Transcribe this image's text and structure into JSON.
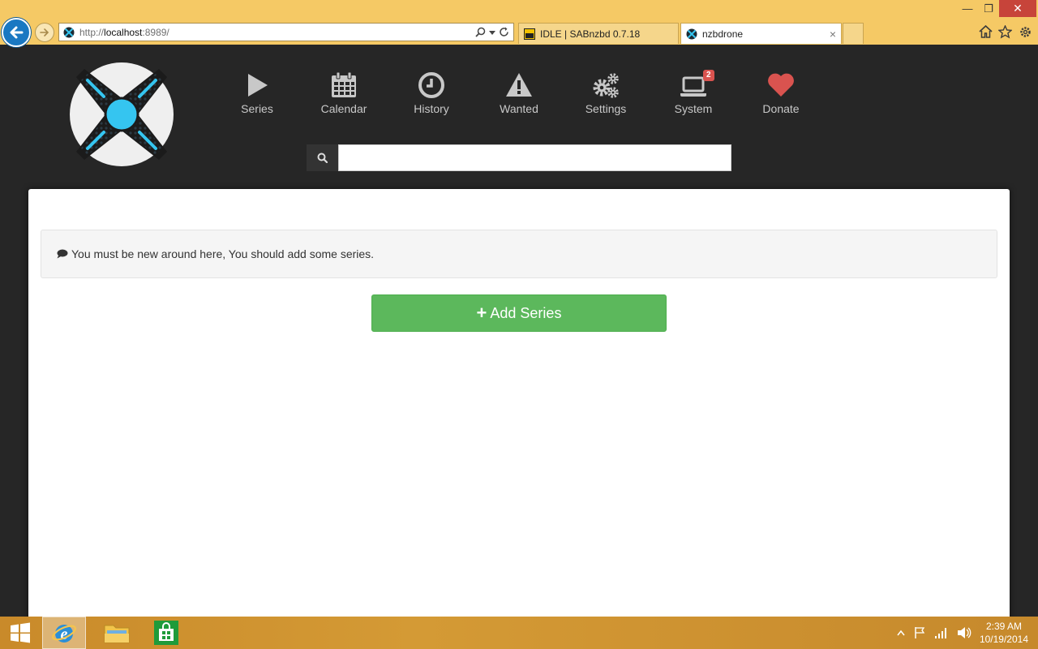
{
  "browser": {
    "url": {
      "protocol": "http://",
      "host": "localhost",
      "port": ":8989/"
    },
    "tabs": [
      {
        "title": "IDLE | SABnzbd 0.7.18",
        "icon": "sabnzbd-icon",
        "active": false
      },
      {
        "title": "nzbdrone",
        "icon": "nzbdrone-icon",
        "active": true,
        "close": "×"
      }
    ],
    "window": {
      "minimize": "—",
      "maximize": "❐",
      "close": "✕"
    }
  },
  "app": {
    "menu": [
      {
        "id": "series",
        "label": "Series",
        "icon": "play-icon"
      },
      {
        "id": "calendar",
        "label": "Calendar",
        "icon": "calendar-icon"
      },
      {
        "id": "history",
        "label": "History",
        "icon": "clock-icon"
      },
      {
        "id": "wanted",
        "label": "Wanted",
        "icon": "warning-icon"
      },
      {
        "id": "settings",
        "label": "Settings",
        "icon": "gears-icon"
      },
      {
        "id": "system",
        "label": "System",
        "icon": "laptop-icon",
        "badge": "2"
      },
      {
        "id": "donate",
        "label": "Donate",
        "icon": "heart-icon"
      }
    ],
    "search": {
      "value": "",
      "placeholder": ""
    },
    "notice": "You must be new around here, You should add some series.",
    "add_series_label": "Add Series",
    "colors": {
      "accent": "#35c5f0",
      "success": "#5cb85c",
      "danger": "#d9534f",
      "header_bg": "#262626"
    }
  },
  "taskbar": {
    "time": "2:39 AM",
    "date": "10/19/2014"
  }
}
